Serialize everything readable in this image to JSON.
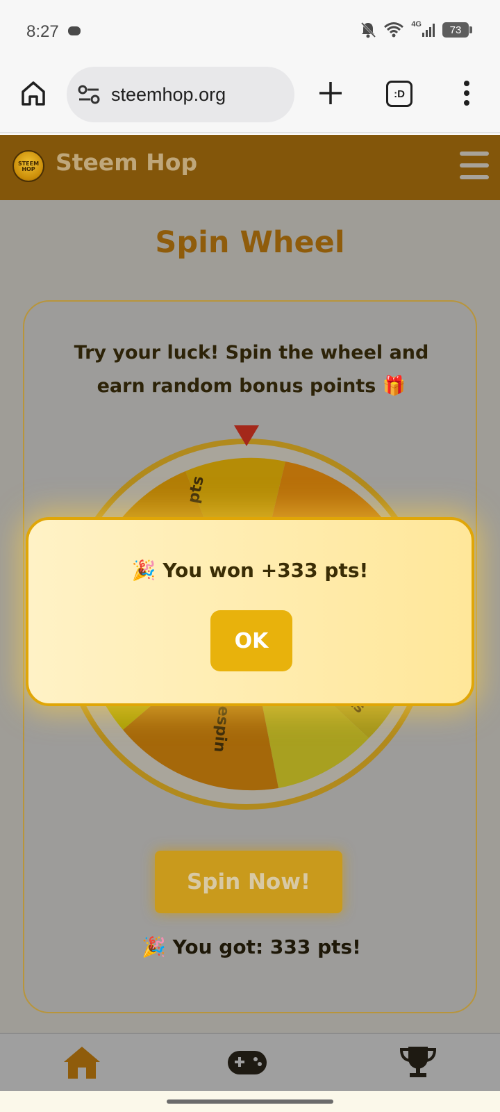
{
  "status_bar": {
    "time": "8:27",
    "network": "4G",
    "battery": "73"
  },
  "browser": {
    "url": "steemhop.org",
    "tabs_label": ":D"
  },
  "site": {
    "title": "Steem Hop",
    "logo_text": "STEEM HOP"
  },
  "page": {
    "title": "Spin Wheel",
    "intro": "Try your luck! Spin the wheel and earn random bonus points 🎁",
    "wheel_labels": {
      "top": "pts",
      "right": "pts",
      "bottom": "Respin"
    },
    "spin_button": "Spin Now!",
    "result": "🎉 You got: 333 pts!"
  },
  "modal": {
    "message": "🎉 You won +333 pts!",
    "ok_label": "OK"
  },
  "bottom_nav": {
    "items": [
      {
        "icon": "home-icon"
      },
      {
        "icon": "gamepad-icon"
      },
      {
        "icon": "trophy-icon"
      }
    ]
  },
  "colors": {
    "header": "#83560a",
    "accent": "#e8b20c",
    "title": "#8f5c0b"
  }
}
